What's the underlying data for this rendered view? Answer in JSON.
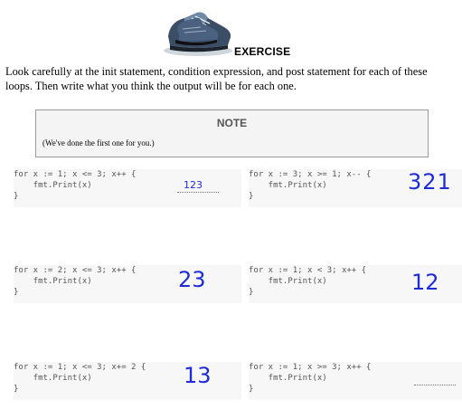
{
  "header": {
    "icon": "running-shoe-icon",
    "title": "EXERCISE",
    "intro": "Look carefully at the init statement, condition expression, and post statement for each of these loops. Then write what you think the output will be for each one."
  },
  "note": {
    "title": "NOTE",
    "text": "(We've done the first one for you.)"
  },
  "exercises": [
    {
      "line1": "for x := 1; x <= 3; x++ {",
      "line2": "    fmt.Print(x)",
      "line3": "}",
      "answer": "123"
    },
    {
      "line1": "for x := 3; x >= 1; x-- {",
      "line2": "    fmt.Print(x)",
      "line3": "}",
      "answer": "321"
    },
    {
      "line1": "for x := 2; x <= 3; x++ {",
      "line2": "    fmt.Print(x)",
      "line3": "}",
      "answer": "23"
    },
    {
      "line1": "for x := 1; x < 3; x++ {",
      "line2": "    fmt.Print(x)",
      "line3": "}",
      "answer": "12"
    },
    {
      "line1": "for x := 1; x <= 3; x+= 2 {",
      "line2": "    fmt.Print(x)",
      "line3": "}",
      "answer": "13"
    },
    {
      "line1": "for x := 1; x >= 3; x++ {",
      "line2": "    fmt.Print(x)",
      "line3": "}",
      "answer": ""
    }
  ],
  "colors": {
    "handwriting": "#1e2bd8",
    "panel": "#f7f7f7",
    "note_bg": "#f4f4f4"
  }
}
